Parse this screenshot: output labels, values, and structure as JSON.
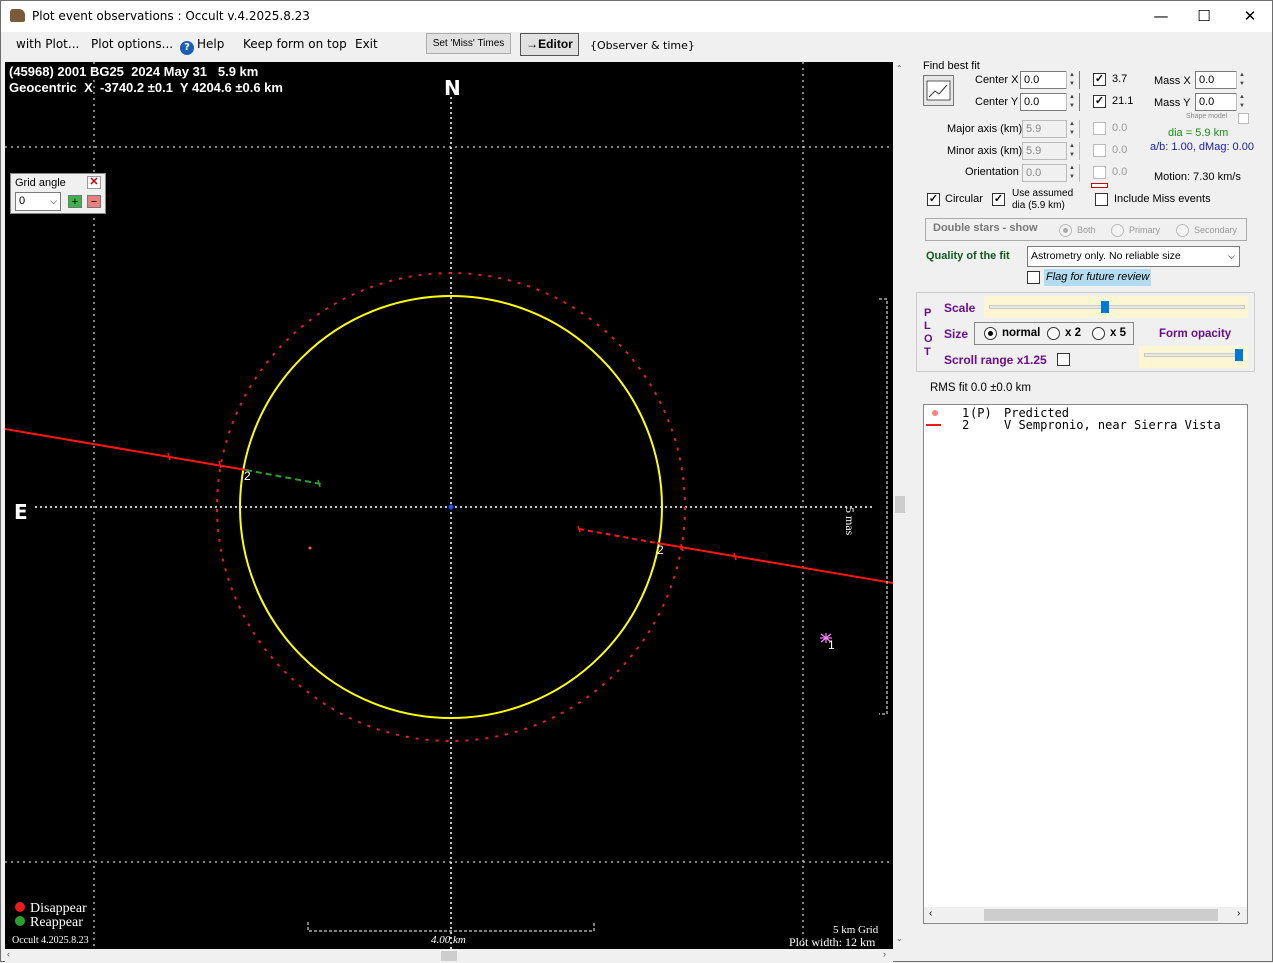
{
  "window": {
    "title": "Plot event observations : Occult v.4.2025.8.23"
  },
  "title_controls": {
    "minimize": "—",
    "maximize": "☐",
    "close": "✕"
  },
  "menu": {
    "with_plot": "with Plot...",
    "plot_options": "Plot options...",
    "help": "Help",
    "keep_on_top": "Keep form on top",
    "exit": "Exit",
    "set_miss_times": "Set 'Miss' Times",
    "editor": "→Editor",
    "observer_time": "{Observer & time}"
  },
  "plot": {
    "header_line1": "(45968) 2001 BG25  2024 May 31   5.9 km",
    "header_line2": "Geocentric  X  -3740.2 ±0.1  Y 4204.6 ±0.6 km",
    "north_label": "N",
    "east_label": "E",
    "scale_label": "5 mas",
    "scale_bar_label": "4.00 km",
    "grid_info": "5 km Grid",
    "plot_width": "Plot width: 12 km",
    "version": "Occult 4.2025.8.23",
    "legend": [
      {
        "label": "Disappear",
        "color": "#e81e1e"
      },
      {
        "label": "Reappear",
        "color": "#2ca02c"
      }
    ],
    "chord_labels": {
      "chord2_left": "2",
      "chord2_right": "2",
      "predicted_marker": "1"
    },
    "colors": {
      "ellipse": "#ffff00",
      "chord": "#ff1414",
      "dashed_limit": "#e02020",
      "grid": "#ffffff",
      "reappear_chord": "#2ca02c"
    }
  },
  "grid_angle": {
    "label": "Grid angle",
    "value": "0",
    "plus": "+",
    "minus": "−",
    "close": "✕"
  },
  "fit": {
    "find_best_fit": "Find best fit",
    "center_x_label": "Center X",
    "center_x": "0.0",
    "center_y_label": "Center Y",
    "center_y": "0.0",
    "check_center_x": "3.7",
    "check_center_y": "21.1",
    "mass_x_label": "Mass X",
    "mass_x": "0.0",
    "mass_y_label": "Mass Y",
    "mass_y": "0.0",
    "shape_model": "Shape model",
    "major_axis_label": "Major axis (km)",
    "major_axis": "5.9",
    "minor_axis_label": "Minor axis (km)",
    "minor_axis": "5.9",
    "orientation_label": "Orientation",
    "orientation": "0.0",
    "disabled_major": "0.0",
    "disabled_minor": "0.0",
    "disabled_orient": "0.0",
    "dia": "dia = 5.9 km",
    "ab": "a/b: 1.00, dMag: 0.00",
    "motion": "Motion: 7.30 km/s",
    "circular": "Circular",
    "use_assumed": "Use assumed",
    "use_assumed_2": "dia (5.9 km)",
    "include_miss": "Include Miss events",
    "double_stars": "Double stars - show",
    "both": "Both",
    "primary": "Primary",
    "secondary": "Secondary",
    "quality_label": "Quality of the fit",
    "quality_value": "Astrometry only. No reliable size",
    "flag_review": "Flag for future review"
  },
  "plot_panel": {
    "plot_letters": [
      "P",
      "L",
      "O",
      "T"
    ],
    "scale": "Scale",
    "size": "Size",
    "normal": "normal",
    "x2": "x 2",
    "x5": "x 5",
    "form_opacity": "Form opacity",
    "scroll_range": "Scroll range x1.25",
    "scale_level": 0.45,
    "opacity_level": 1.0
  },
  "rms": "RMS fit 0.0 ±0.0 km",
  "observers": [
    {
      "num": "1",
      "flag": "(P)",
      "name": "Predicted"
    },
    {
      "num": "2",
      "flag": "   ",
      "name": "V Sempronio, near Sierra Vista"
    }
  ]
}
